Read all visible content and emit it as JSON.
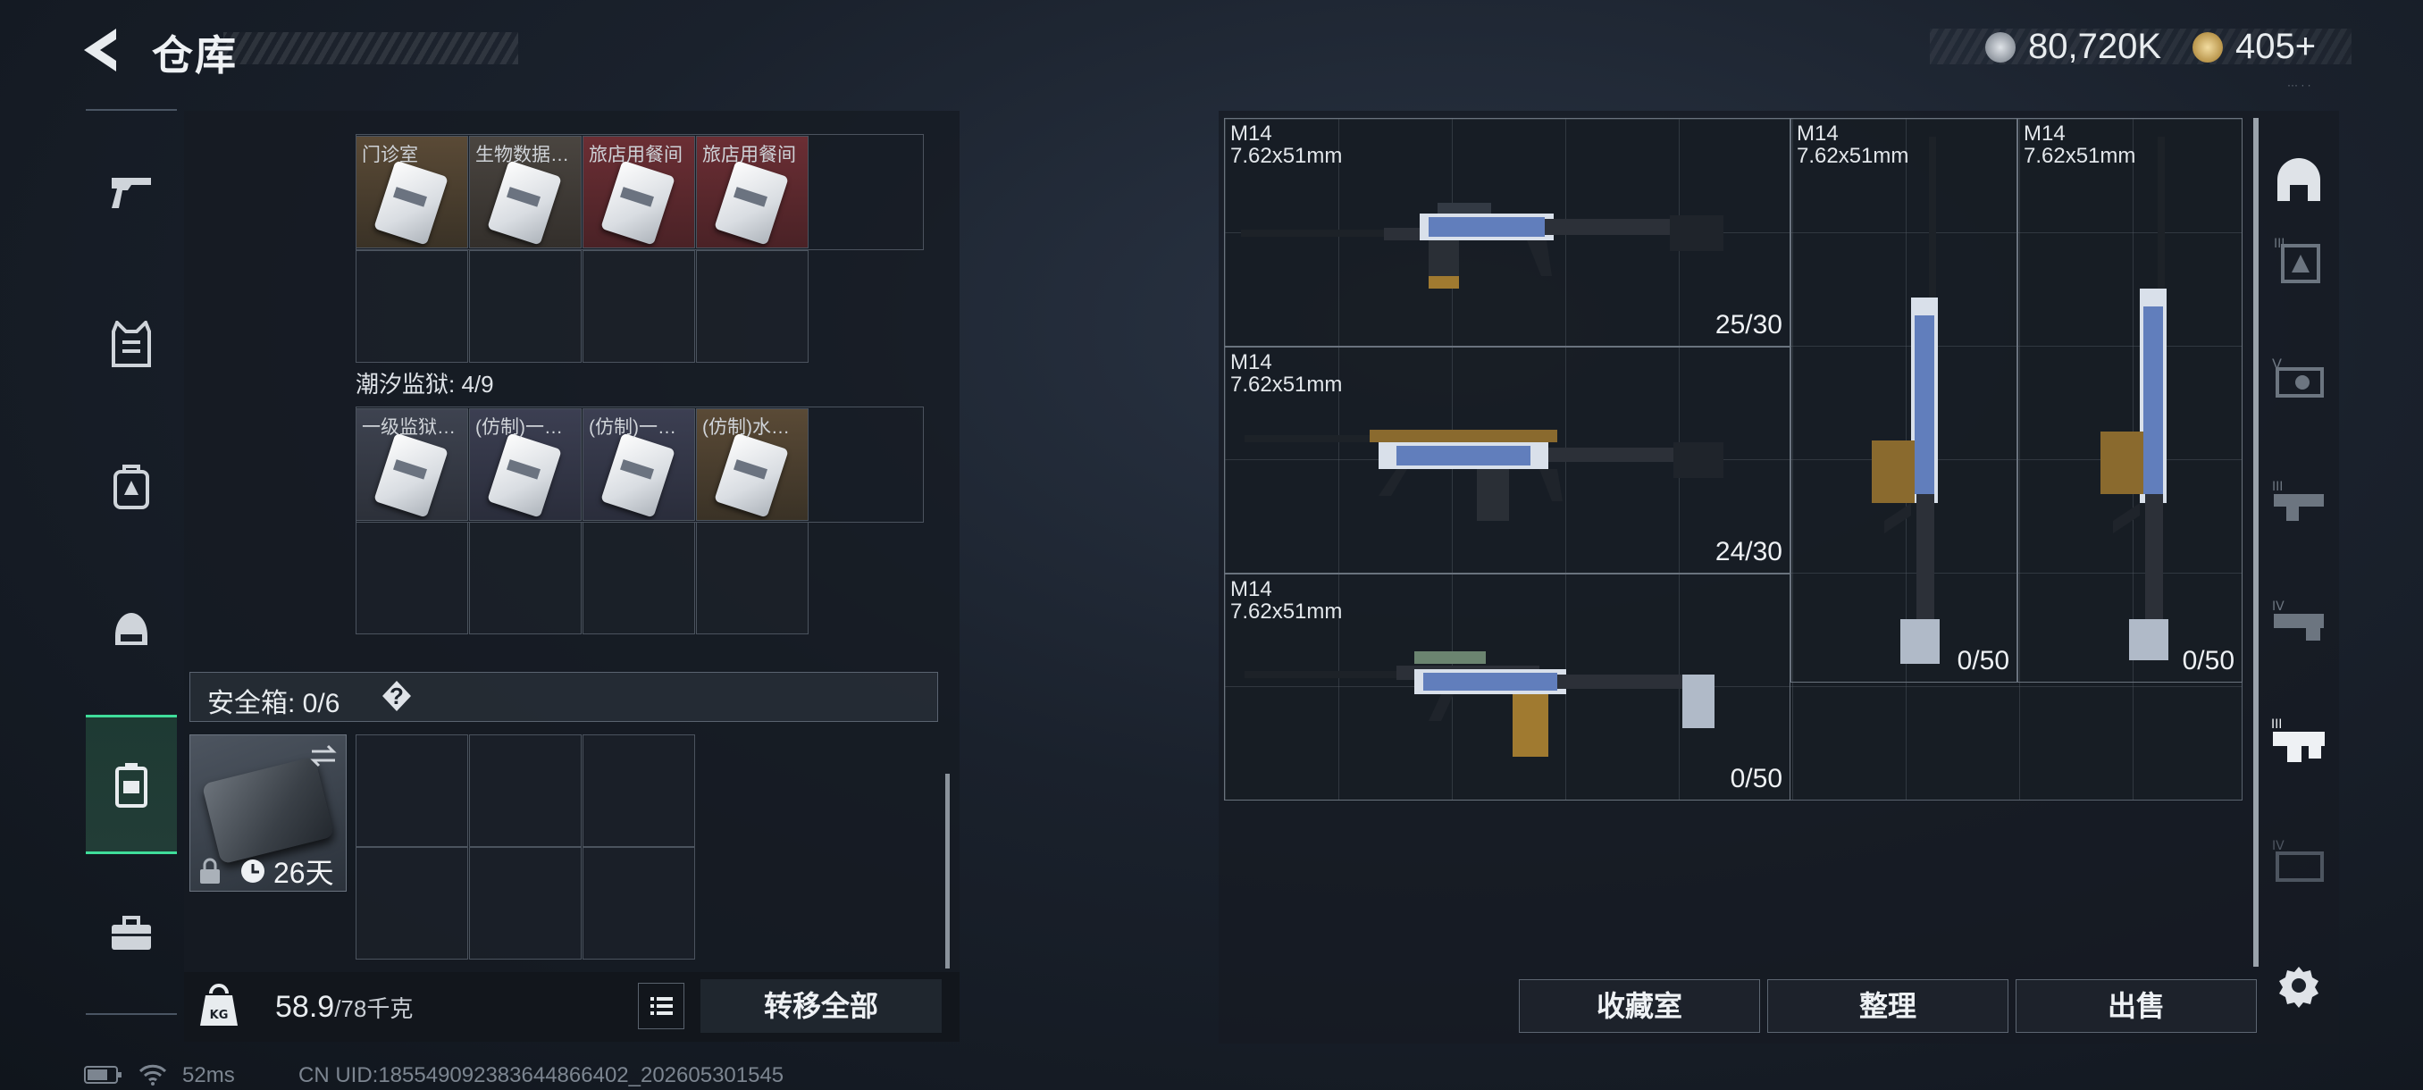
{
  "header": {
    "title": "仓库",
    "silver": "80,720K",
    "gold": "405+",
    "corner_text": "··· · ·"
  },
  "left_nav": [
    {
      "icon": "pistol-icon"
    },
    {
      "icon": "vest-icon"
    },
    {
      "icon": "backpack-icon"
    },
    {
      "icon": "helmet-icon"
    },
    {
      "icon": "safe-case-icon",
      "active": true
    },
    {
      "icon": "toolbox-icon"
    }
  ],
  "storage": {
    "section1_items": [
      "门诊室",
      "生物数据…",
      "旅店用餐间",
      "旅店用餐间"
    ],
    "section2_title": "潮汐监狱: 4/9",
    "section2_items": [
      "一级监狱…",
      "(仿制)一…",
      "(仿制)一…",
      "(仿制)水…"
    ],
    "safe_box_label": "安全箱: 0/6",
    "help": "?",
    "case_time": "26天"
  },
  "bottom": {
    "weight_value": "58.9",
    "weight_total": "/78千克",
    "transfer_all": "转移全部"
  },
  "status": {
    "ping": "52ms",
    "uid": "CN UID:185549092383644866402_202605301545"
  },
  "weapons": [
    {
      "name": "M14",
      "caliber": "7.62x51mm",
      "ammo": "25/30"
    },
    {
      "name": "M14",
      "caliber": "7.62x51mm",
      "ammo": "24/30"
    },
    {
      "name": "M14",
      "caliber": "7.62x51mm",
      "ammo": "0/50"
    },
    {
      "name": "M14",
      "caliber": "7.62x51mm",
      "ammo": "0/50"
    },
    {
      "name": "M14",
      "caliber": "7.62x51mm",
      "ammo": "0/50"
    }
  ],
  "right_nav": [
    {
      "icon": "helmet-slot-icon"
    },
    {
      "icon": "armor-iii-icon"
    },
    {
      "icon": "armor-v-icon"
    },
    {
      "icon": "gun-iii-icon"
    },
    {
      "icon": "gun-iv-icon"
    },
    {
      "icon": "gun-iii-active-icon",
      "active": true
    },
    {
      "icon": "gun-iv-dim-icon"
    }
  ],
  "actions": {
    "collection": "收藏室",
    "organize": "整理",
    "sell": "出售"
  }
}
